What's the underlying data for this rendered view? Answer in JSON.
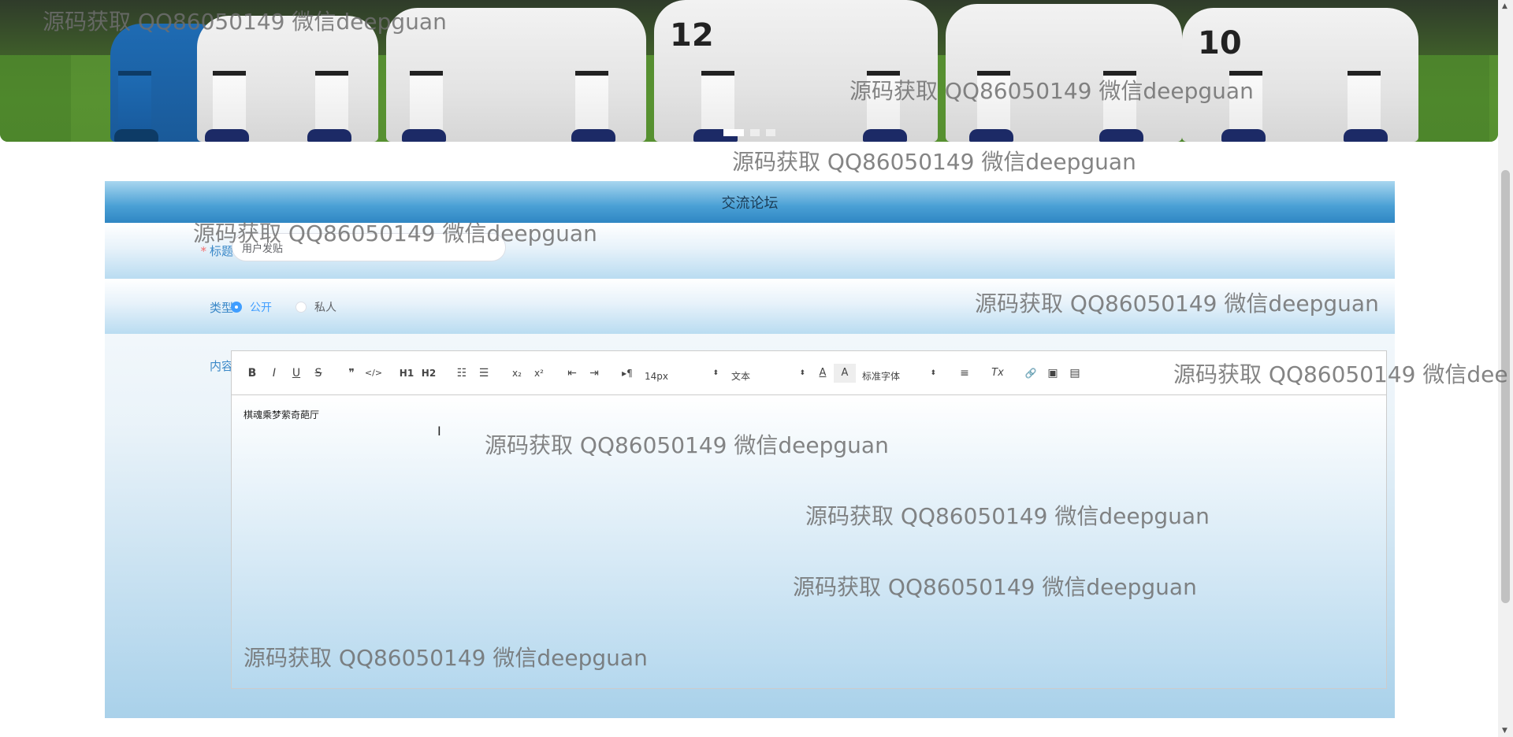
{
  "carousel": {
    "slide_count": 3,
    "active_slide": 1,
    "player_numbers": [
      "12",
      "10"
    ]
  },
  "forum": {
    "header": "交流论坛",
    "title_label": "标题",
    "title_value": "用户发贴",
    "type_label": "类型",
    "type_options": [
      "公开",
      "私人"
    ],
    "type_selected": "公开",
    "content_label": "内容",
    "toolbar": {
      "bold": "B",
      "italic": "I",
      "underline": "U",
      "strike": "S",
      "quote": "❞",
      "code": "</>",
      "h1": "H1",
      "h2": "H2",
      "ordered_list": "☷",
      "bullet_list": "☰",
      "subscript": "x₂",
      "superscript": "x²",
      "indent_decrease": "⇤",
      "indent_increase": "⇥",
      "direction": "▸¶",
      "font_size": "14px",
      "header_select": "文本",
      "font_family": "标准字体",
      "text_color": "A",
      "background_color": "A",
      "align": "≡",
      "clean": "Tx",
      "link": "🔗",
      "image": "▣",
      "video": "▤"
    },
    "content_text": "棋魂乘梦萦奇葩厅"
  },
  "watermarks": [
    "源码获取 QQ86050149 微信deepguan",
    "源码获取 QQ86050149 微信deepguan",
    "源码获取 QQ86050149 微信deepguan",
    "源码获取 QQ86050149 微信deepguan",
    "源码获取 QQ86050149 微信deepguan",
    "源码获取 QQ86050149 微信dee",
    "源码获取 QQ86050149 微信deepguan",
    "源码获取 QQ86050149 微信deepguan",
    "源码获取 QQ86050149 微信deepguan",
    "源码获取 QQ86050149 微信deepguan"
  ]
}
